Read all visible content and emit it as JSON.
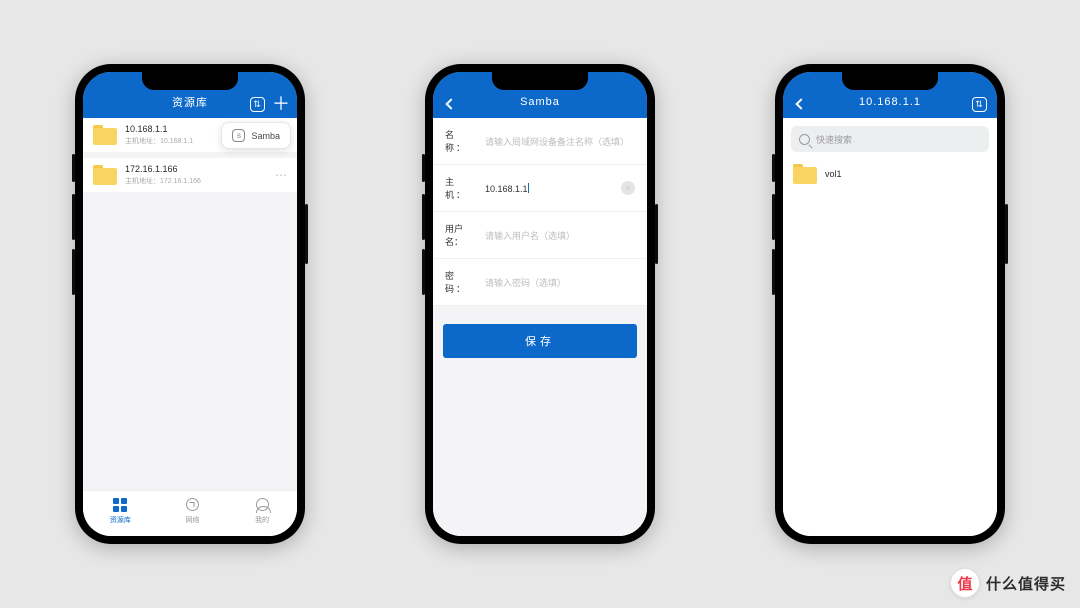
{
  "phone1": {
    "title": "资源库",
    "popover_label": "Samba",
    "items": [
      {
        "title": "10.168.1.1",
        "sub": "主机地址：10.168.1.1"
      },
      {
        "title": "172.16.1.166",
        "sub": "主机地址：172.16.1.166"
      }
    ],
    "tabs": {
      "library": "资源库",
      "network": "网络",
      "mine": "我的"
    }
  },
  "phone2": {
    "title": "Samba",
    "fields": {
      "name_label": "名 称：",
      "name_placeholder": "请输入局域网设备备注名称（选填）",
      "host_label": "主 机：",
      "host_value": "10.168.1.1",
      "user_label": "用户名：",
      "user_placeholder": "请输入用户名（选填）",
      "pass_label": "密 码：",
      "pass_placeholder": "请输入密码（选填）"
    },
    "save_label": "保存"
  },
  "phone3": {
    "title": "10.168.1.1",
    "search_placeholder": "快速搜索",
    "items": [
      {
        "title": "vol1"
      }
    ]
  },
  "watermark": {
    "badge": "值",
    "text": "什么值得买"
  }
}
